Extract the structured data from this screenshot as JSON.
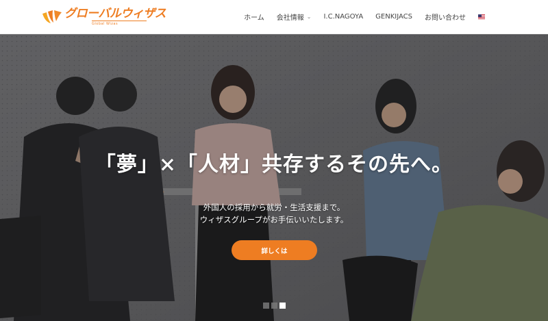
{
  "brand": {
    "logo_text": "グローバルウィザス",
    "logo_sub": "Global Wizas",
    "accent_color": "#ee7d22"
  },
  "nav": {
    "items": [
      {
        "label": "ホーム"
      },
      {
        "label": "会社情報",
        "has_dropdown": true
      },
      {
        "label": "I.C.NAGOYA"
      },
      {
        "label": "GENKIJACS"
      },
      {
        "label": "お問い合わせ"
      }
    ],
    "language_icon": "us-flag-icon"
  },
  "hero": {
    "title": "「夢」×「人材」共存するその先へ。",
    "subtitle_line1": "外国人の採用から就労・生活支援まで。",
    "subtitle_line2": "ウィザスグループがお手伝いいたします。",
    "cta_label": "詳しくは",
    "slides_total": 3,
    "active_slide": 3
  }
}
